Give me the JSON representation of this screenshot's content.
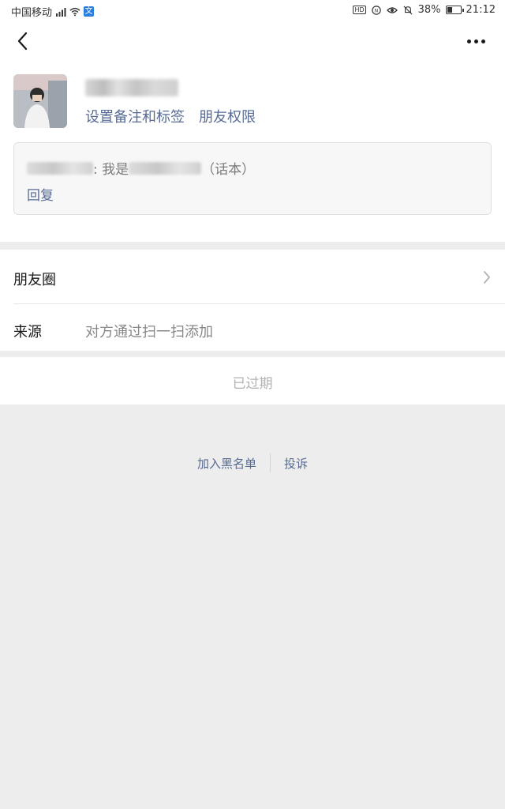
{
  "status_bar": {
    "carrier": "中国移动",
    "network": "4G",
    "app_badge": "文",
    "hd": "HD",
    "battery": "38%",
    "battery_level": 0.38,
    "time": "21:12"
  },
  "header": {
    "back_icon": "chevron-left-icon",
    "more_icon": "more-dots-icon"
  },
  "profile": {
    "links": {
      "remark": "设置备注和标签",
      "permission": "朋友权限"
    },
    "greeting": {
      "prefix_sep": ": 我是",
      "suffix": "（话本）",
      "reply": "回复"
    }
  },
  "rows": {
    "moments": {
      "label": "朋友圈"
    },
    "source": {
      "label": "来源",
      "value": "对方通过扫一扫添加"
    }
  },
  "expired": {
    "label": "已过期"
  },
  "bottom_actions": {
    "blacklist": "加入黑名单",
    "report": "投诉"
  },
  "colors": {
    "link": "#576b95",
    "background": "#ededed",
    "muted": "#b2b2b2"
  }
}
